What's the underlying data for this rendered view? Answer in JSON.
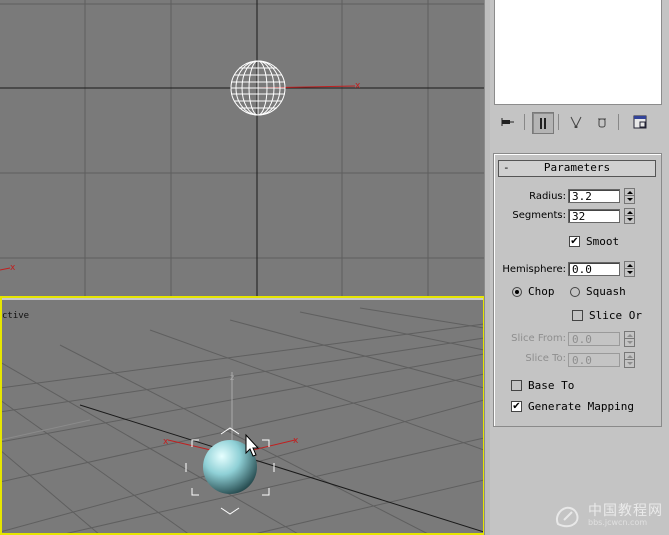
{
  "viewports": {
    "top_axis_label": "x",
    "left_axis_label": "x",
    "perspective_label": "ctive",
    "perspective_axis_labels": [
      "x",
      "x",
      "z"
    ]
  },
  "command_panel": {
    "toolbar": [
      {
        "icon": "pin-stack-icon"
      },
      {
        "icon": "show-end-result-icon"
      },
      {
        "icon": "make-unique-icon"
      },
      {
        "icon": "remove-modifier-icon"
      },
      {
        "icon": "configure-modifier-sets-icon"
      }
    ],
    "rollout": {
      "collapse_symbol": "-",
      "title": "Parameters",
      "radius_label": "Radius:",
      "radius_value": "3.2",
      "segments_label": "Segments:",
      "segments_value": "32",
      "smooth_label": "Smoot",
      "smooth_checked": true,
      "hemisphere_label": "Hemisphere:",
      "hemisphere_value": "0.0",
      "chop_label": "Chop",
      "squash_label": "Squash",
      "selected_mode": "Chop",
      "slice_on_label": "Slice Or",
      "slice_on_checked": false,
      "slice_from_label": "Slice From:",
      "slice_from_value": "0.0",
      "slice_to_label": "Slice To:",
      "slice_to_value": "0.0",
      "base_to_pivot_label": "Base To",
      "base_to_pivot_checked": false,
      "generate_mapping_label": "Generate Mapping",
      "generate_mapping_checked": true,
      "check_mark": "✔"
    }
  },
  "watermark": {
    "brand": "中国教程网",
    "url": "bbs.jcwcn.com"
  },
  "colors": {
    "viewport_bg": "#7a7a7a",
    "grid_line": "#5e5e5e",
    "axis_x": "#c02020",
    "active_border": "#e6e600",
    "sphere": "#8fd0d6"
  }
}
